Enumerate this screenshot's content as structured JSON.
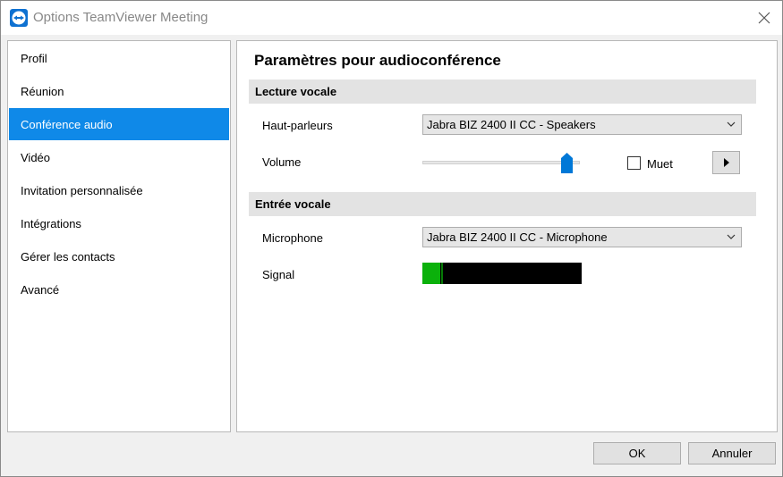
{
  "window": {
    "title": "Options TeamViewer Meeting",
    "icon": "teamviewer-logo-icon",
    "close_icon": "close-icon"
  },
  "sidebar": {
    "items": [
      {
        "label": "Profil",
        "active": false
      },
      {
        "label": "Réunion",
        "active": false
      },
      {
        "label": "Conférence audio",
        "active": true
      },
      {
        "label": "Vidéo",
        "active": false
      },
      {
        "label": "Invitation personnalisée",
        "active": false
      },
      {
        "label": "Intégrations",
        "active": false
      },
      {
        "label": "Gérer les contacts",
        "active": false
      },
      {
        "label": "Avancé",
        "active": false
      }
    ]
  },
  "main": {
    "heading": "Paramètres pour audioconférence",
    "playback": {
      "section_title": "Lecture vocale",
      "speakers_label": "Haut-parleurs",
      "speakers_value": "Jabra BIZ 2400 II CC - Speakers",
      "volume_label": "Volume",
      "volume_level": 0.95,
      "mute_label": "Muet",
      "mute_checked": false,
      "test_icon": "play-icon"
    },
    "input": {
      "section_title": "Entrée vocale",
      "microphone_label": "Microphone",
      "microphone_value": "Jabra BIZ 2400 II CC - Microphone",
      "signal_label": "Signal",
      "signal_level": 0.11,
      "signal_peak": 0.12
    }
  },
  "buttons": {
    "ok": "OK",
    "cancel": "Annuler"
  },
  "colors": {
    "accent": "#0f89e8",
    "slider_thumb": "#0078d7",
    "signal": "#0bb10b",
    "section_bar": "#e3e3e3"
  }
}
